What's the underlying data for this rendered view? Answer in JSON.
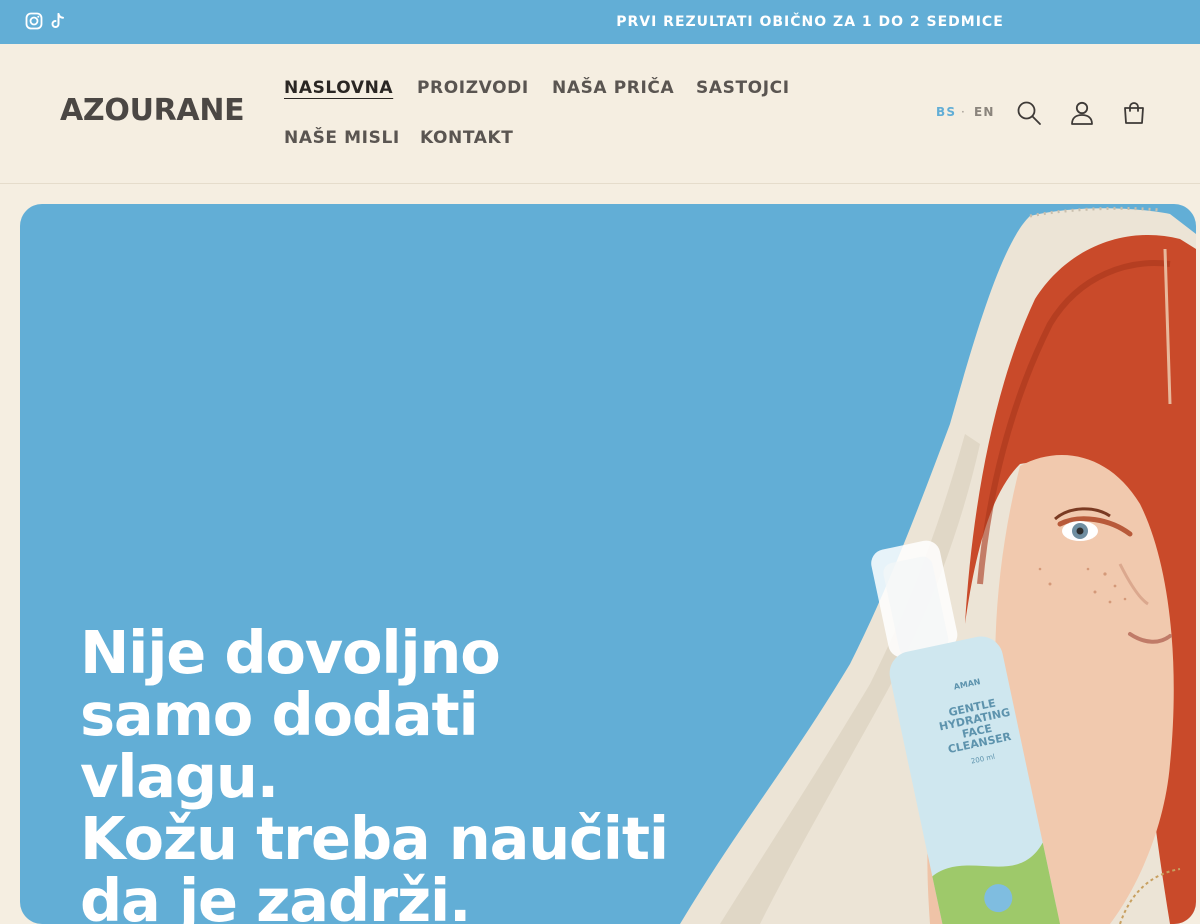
{
  "announcement": {
    "text": "PRVI REZULTATI OBIČNO ZA 1 DO 2 SEDMICE",
    "social": [
      "instagram-icon",
      "tiktok-icon"
    ]
  },
  "header": {
    "logo": "AZOURANE",
    "nav": [
      {
        "label": "NASLOVNA",
        "active": true
      },
      {
        "label": "PROIZVODI"
      },
      {
        "label": "NAŠA PRIČA"
      },
      {
        "label": "SASTOJCI"
      },
      {
        "label": "NAŠE MISLI"
      },
      {
        "label": "KONTAKT"
      }
    ],
    "languages": {
      "current": "BS",
      "separator": "·",
      "other": "EN"
    },
    "icons": [
      "search-icon",
      "account-icon",
      "cart-icon"
    ]
  },
  "hero": {
    "headline_lines": [
      "Nije dovoljno",
      "samo dodati",
      "vlagu.",
      "Kožu treba naučiti",
      "da je zadrži."
    ],
    "product_label": {
      "brand": "AMAN",
      "name_lines": [
        "GENTLE",
        "HYDRATING",
        "FACE",
        "CLEANSER"
      ],
      "volume": "200 ml"
    }
  },
  "colors": {
    "accent_blue": "#62aed6",
    "background_cream": "#f5eee1",
    "text_dark": "#4b4744",
    "hair_red": "#c94a2a"
  }
}
